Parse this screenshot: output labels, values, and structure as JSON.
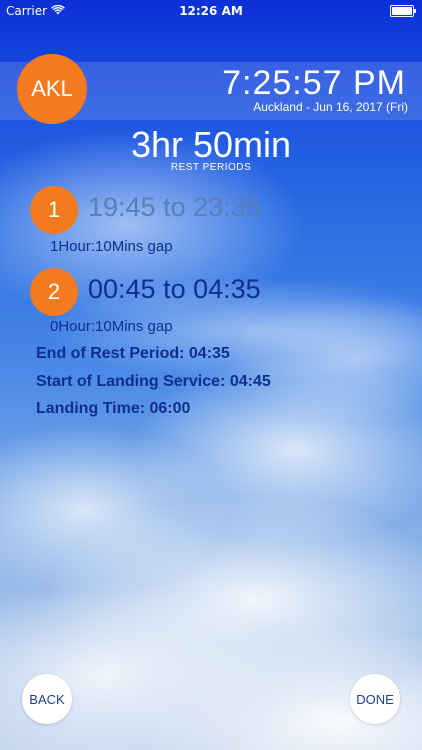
{
  "status_bar": {
    "carrier": "Carrier",
    "time": "12:26 AM",
    "battery_level": 1.0
  },
  "header": {
    "airport_code": "AKL",
    "local_time": "7:25:57 PM",
    "location_date": "Auckland - Jun 16, 2017 (Fri)"
  },
  "summary": {
    "total_rest": "3hr 50min",
    "label": "REST PERIODS"
  },
  "periods": [
    {
      "number": "1",
      "range": "19:45 to 23:35",
      "gap": "1Hour:10Mins gap"
    },
    {
      "number": "2",
      "range": "00:45 to 04:35",
      "gap": "0Hour:10Mins gap"
    }
  ],
  "details": [
    "End of Rest Period: 04:35",
    "Start of Landing Service: 04:45",
    "Landing Time: 06:00"
  ],
  "buttons": {
    "back": "BACK",
    "done": "DONE"
  },
  "colors": {
    "accent": "#f47a1f",
    "text_dark_blue": "#0f2f8f",
    "text_muted_blue": "#5a7fb4"
  },
  "icons": {
    "wifi": "wifi-icon",
    "battery": "battery-icon"
  }
}
